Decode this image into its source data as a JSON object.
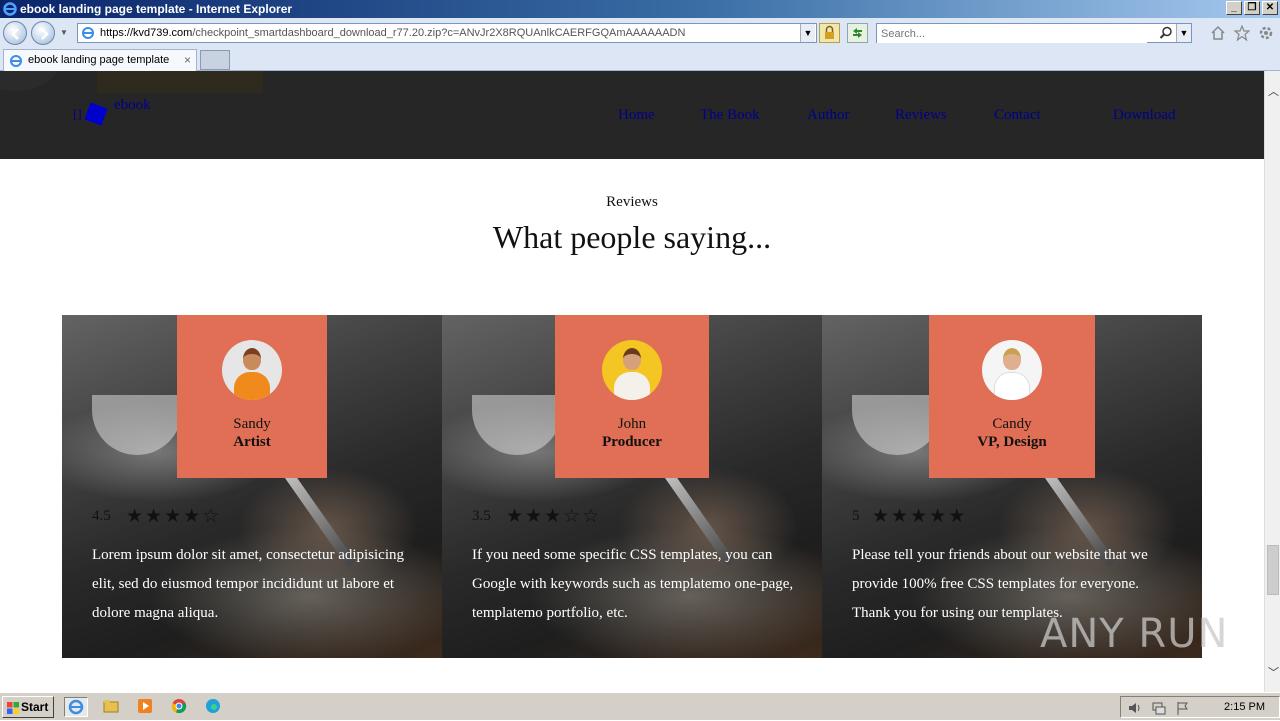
{
  "window": {
    "title": "ebook landing page template - Internet Explorer",
    "buttons": [
      "_",
      "❐",
      "✕"
    ]
  },
  "address": {
    "url_host": "https://kvd739.com",
    "url_path": "/checkpoint_smartdashboard_download_r77.20.zip?c=ANvJr2X8RQUAnlkCAERFGQAmAAAAAADN",
    "search_placeholder": "Search..."
  },
  "tabs": [
    {
      "label": "ebook landing page template"
    }
  ],
  "site": {
    "logo_text": "ebook",
    "logo_bracket": "[]",
    "menu": [
      "Home",
      "The Book",
      "Author",
      "Reviews",
      "Contact",
      "Download"
    ]
  },
  "section": {
    "subtitle": "Reviews",
    "title": "What people saying..."
  },
  "reviews": [
    {
      "name": "Sandy",
      "role": "Artist",
      "rating": "4.5",
      "stars": [
        "★",
        "★",
        "★",
        "★",
        "☆"
      ],
      "text": "Lorem ipsum dolor sit amet, consectetur adipisicing elit, sed do eiusmod tempor incididunt ut labore et dolore magna aliqua."
    },
    {
      "name": "John",
      "role": "Producer",
      "rating": "3.5",
      "stars": [
        "★",
        "★",
        "★",
        "☆",
        "☆"
      ],
      "text": "If you need some specific CSS templates, you can Google with keywords such as templatemo one-page, templatemo portfolio, etc."
    },
    {
      "name": "Candy",
      "role": "VP, Design",
      "rating": "5",
      "stars": [
        "★",
        "★",
        "★",
        "★",
        "★"
      ],
      "text": "Please tell your friends about our website that we provide 100% free CSS templates for everyone. Thank you for using our templates."
    }
  ],
  "watermark": "ANY RUN",
  "taskbar": {
    "start_label": "Start",
    "clock": "2:15 PM"
  },
  "colors": {
    "accent": "#e16f55",
    "nav_bg": "#262626",
    "link": "#00008b"
  }
}
